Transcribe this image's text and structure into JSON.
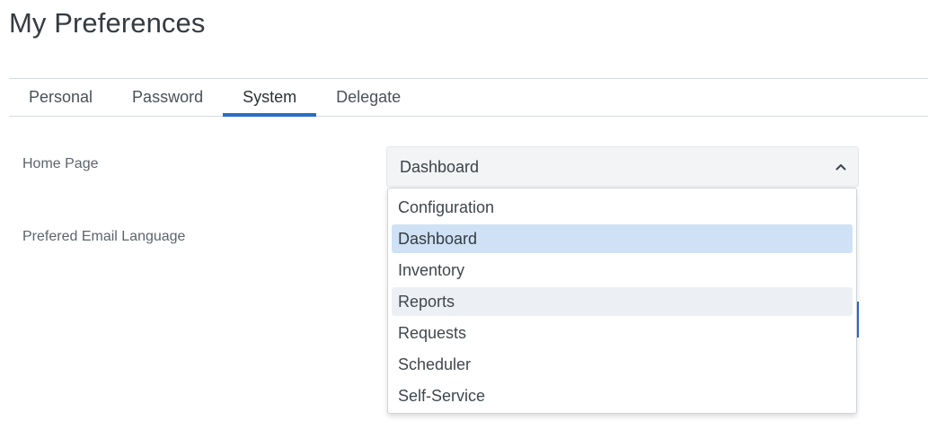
{
  "page": {
    "title": "My Preferences"
  },
  "tabs": [
    {
      "label": "Personal",
      "active": false
    },
    {
      "label": "Password",
      "active": false
    },
    {
      "label": "System",
      "active": true
    },
    {
      "label": "Delegate",
      "active": false
    }
  ],
  "form": {
    "home_page_label": "Home Page",
    "email_language_label": "Prefered Email Language",
    "home_page_value": "Dashboard"
  },
  "dropdown": {
    "options": [
      {
        "label": "Configuration",
        "state": "normal"
      },
      {
        "label": "Dashboard",
        "state": "selected"
      },
      {
        "label": "Inventory",
        "state": "normal"
      },
      {
        "label": "Reports",
        "state": "hovered"
      },
      {
        "label": "Requests",
        "state": "normal"
      },
      {
        "label": "Scheduler",
        "state": "normal"
      },
      {
        "label": "Self-Service",
        "state": "normal"
      }
    ]
  },
  "colors": {
    "accent": "#2a6ec6",
    "selected_option_bg": "#cfe1f5",
    "hover_option_bg": "#ecf0f4"
  },
  "icons": {
    "select_toggle": "chevron-up-icon"
  }
}
